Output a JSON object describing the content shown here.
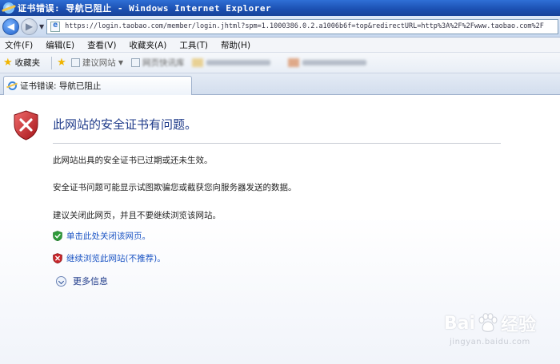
{
  "window": {
    "title": "证书错误: 导航已阻止 - Windows Internet Explorer"
  },
  "address_bar": {
    "url": "https://login.taobao.com/member/login.jhtml?spm=1.1000386.0.2.a1006b6f=top&redirectURL=http%3A%2F%2Fwww.taobao.com%2F"
  },
  "menu": {
    "items": [
      "文件(F)",
      "编辑(E)",
      "查看(V)",
      "收藏夹(A)",
      "工具(T)",
      "帮助(H)"
    ]
  },
  "favorites_bar": {
    "favorites_label": "收藏夹",
    "suggested_sites": "建议网站",
    "web_slice": "网页快讯库"
  },
  "tab": {
    "title": "证书错误: 导航已阻止"
  },
  "content": {
    "heading": "此网站的安全证书有问题。",
    "paragraph1": "此网站出具的安全证书已过期或还未生效。",
    "paragraph2": "安全证书问题可能显示试图欺骗您或截获您向服务器发送的数据。",
    "paragraph3": "建议关闭此网页，并且不要继续浏览该网站。",
    "link_close": "单击此处关闭该网页。",
    "link_continue": "继续浏览此网站(不推荐)。",
    "more_info": "更多信息"
  },
  "watermark": {
    "brand_left": "Bai",
    "brand_right": "经验",
    "domain": "jingyan.baidu.com"
  },
  "colors": {
    "heading": "#1f3b8a",
    "link": "#1b54c4",
    "titlebar": "#1b4fb0",
    "shield_red": "#c8262b"
  }
}
